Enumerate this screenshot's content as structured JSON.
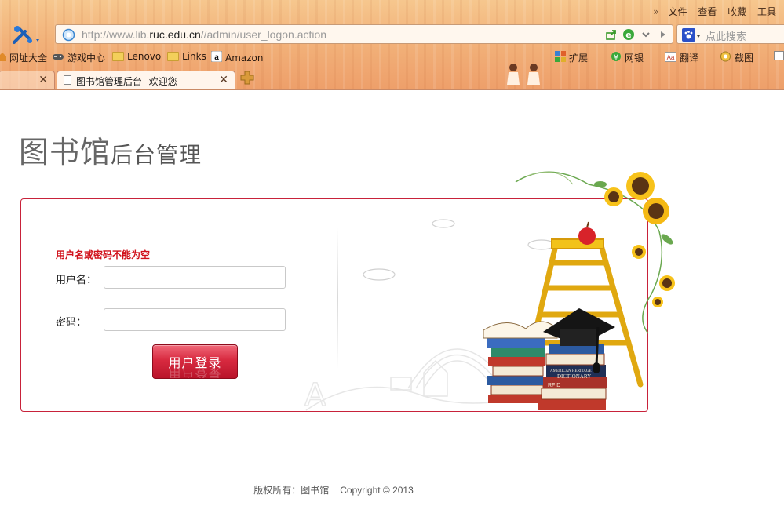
{
  "browser": {
    "menu": [
      "文件",
      "查看",
      "收藏",
      "工具"
    ],
    "url_prefix": "http://www.lib.",
    "url_domain": "ruc.edu.cn",
    "url_path": "//admin/user_logon.action",
    "search_placeholder": "点此搜索",
    "bookmarks": [
      {
        "label": "网址大全",
        "icon": "home-icon"
      },
      {
        "label": "游戏中心",
        "icon": "gamepad-icon"
      },
      {
        "label": "Lenovo",
        "icon": "folder-icon"
      },
      {
        "label": "Links",
        "icon": "folder-icon"
      },
      {
        "label": "Amazon",
        "icon": "amazon-icon"
      }
    ],
    "toolbar_right": [
      {
        "label": "扩展",
        "icon": "extensions-icon"
      },
      {
        "label": "网银",
        "icon": "bank-icon"
      },
      {
        "label": "翻译",
        "icon": "translate-icon"
      },
      {
        "label": "截图",
        "icon": "screenshot-icon"
      }
    ],
    "tabs": [
      {
        "title": "",
        "active": false
      },
      {
        "title": "图书馆管理后台--欢迎您",
        "active": true
      }
    ]
  },
  "page": {
    "title_main": "图书馆",
    "title_sub": "后台管理",
    "error_message": "用户名或密码不能为空",
    "username_label": "用户名：",
    "password_label": "密码：",
    "username_value": "",
    "password_value": "",
    "login_button": "用户登录",
    "illustration": {
      "book_labels": [
        "AMERICAN HERITAGE",
        "DICTIONARY",
        "RFID"
      ]
    }
  },
  "footer": {
    "owner": "版权所有：图书馆",
    "copyright": "Copyright © 2013"
  },
  "colors": {
    "accent": "#c8223a",
    "error": "#d0101a",
    "button": "#d82a40",
    "chrome": "#f2b27a"
  }
}
